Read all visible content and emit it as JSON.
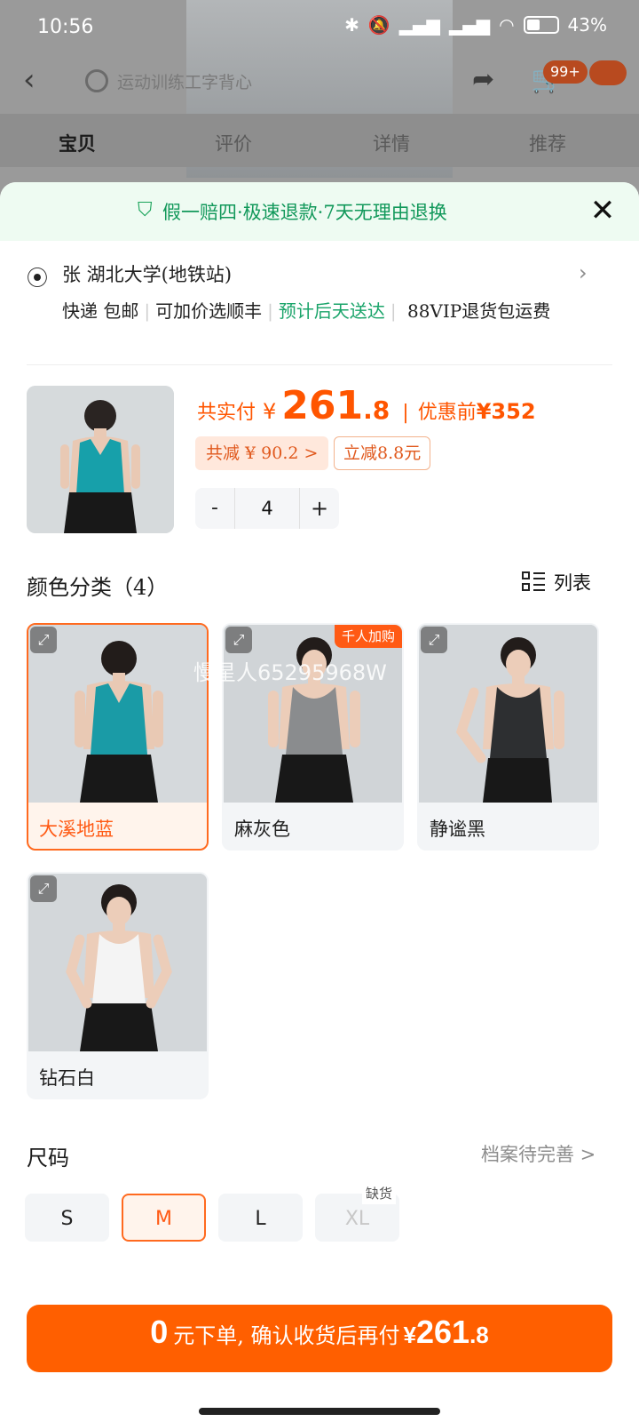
{
  "status_bar": {
    "time": "10:56",
    "battery": "43%"
  },
  "header": {
    "search_placeholder": "运动训练工字背心",
    "cart_badge": "99+"
  },
  "tabs": [
    {
      "label": "宝贝"
    },
    {
      "label": "评价"
    },
    {
      "label": "详情"
    },
    {
      "label": "推荐"
    }
  ],
  "sheet": {
    "guarantee": "假一赔四·极速退款·7天无理由退换",
    "address": "张 湖北大学(地铁站)",
    "delivery": {
      "shipping": "快递 包邮",
      "option": "可加价选顺丰",
      "eta": "预计后天送达",
      "vip": "88VIP退货包运费"
    },
    "price": {
      "label": "共实付",
      "yen": "¥",
      "integer": "261",
      "decimal": ".8",
      "original_label": "优惠前",
      "original": "¥352",
      "discount": "共减 ¥ 90.2 >",
      "coupon": "立减8.8元"
    },
    "quantity": {
      "minus": "-",
      "value": "4",
      "plus": "+"
    },
    "color_section": {
      "title": "颜色分类（4）",
      "view_toggle": "列表",
      "options": [
        {
          "label": "大溪地蓝",
          "color": "#1a9ba6",
          "selected": true
        },
        {
          "label": "麻灰色",
          "color": "#8a8c8e",
          "badge": "千人加购"
        },
        {
          "label": "静谧黑",
          "color": "#2d2f31"
        },
        {
          "label": "钻石白",
          "color": "#f2f2f2"
        }
      ]
    },
    "size_section": {
      "title": "尺码",
      "profile_link": "档案待完善 >",
      "options": [
        {
          "label": "S"
        },
        {
          "label": "M",
          "selected": true
        },
        {
          "label": "L"
        },
        {
          "label": "XL",
          "tag": "缺货",
          "disabled": true
        }
      ]
    },
    "watermark": "慢星人65295968W",
    "cta": {
      "zero": "0",
      "text": "元下单, 确认收货后再付",
      "yen": "¥",
      "integer": "261",
      "decimal": ".8"
    }
  },
  "colors": {
    "accent": "#ff5f00",
    "green": "#11985a"
  }
}
